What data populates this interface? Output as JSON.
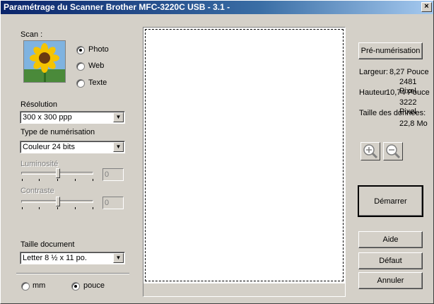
{
  "window": {
    "title": "Paramétrage du Scanner Brother MFC-3220C USB - 3.1 -",
    "close_glyph": "×"
  },
  "scan": {
    "label": "Scan :",
    "options": [
      {
        "label": "Photo",
        "selected": true
      },
      {
        "label": "Web",
        "selected": false
      },
      {
        "label": "Texte",
        "selected": false
      }
    ]
  },
  "resolution": {
    "label": "Résolution",
    "value": "300 x 300 ppp"
  },
  "scan_type": {
    "label": "Type de numérisation",
    "value": "Couleur 24 bits"
  },
  "brightness": {
    "label": "Luminosité",
    "value": "0"
  },
  "contrast": {
    "label": "Contraste",
    "value": "0"
  },
  "doc_size": {
    "label": "Taille document",
    "value": "Letter 8 ½ x 11 po."
  },
  "units": [
    {
      "label": "mm",
      "selected": false
    },
    {
      "label": "pouce",
      "selected": true
    }
  ],
  "buttons": {
    "prescan": "Pré-numérisation",
    "start": "Démarrer",
    "help": "Aide",
    "default": "Défaut",
    "cancel": "Annuler"
  },
  "info": {
    "width_label": "Largeur:",
    "width_value": "8,27 Pouce",
    "width_px": "2481 Pixel",
    "height_label": "Hauteur",
    "height_value": "10,74 Pouce",
    "height_px": "3222 Pixel",
    "size_label": "Taille des données:",
    "size_value": "22,8 Mo"
  },
  "icons": {
    "zoom_in": "zoom-in-icon",
    "zoom_out": "zoom-out-icon",
    "photo": "sunflower-thumbnail"
  }
}
